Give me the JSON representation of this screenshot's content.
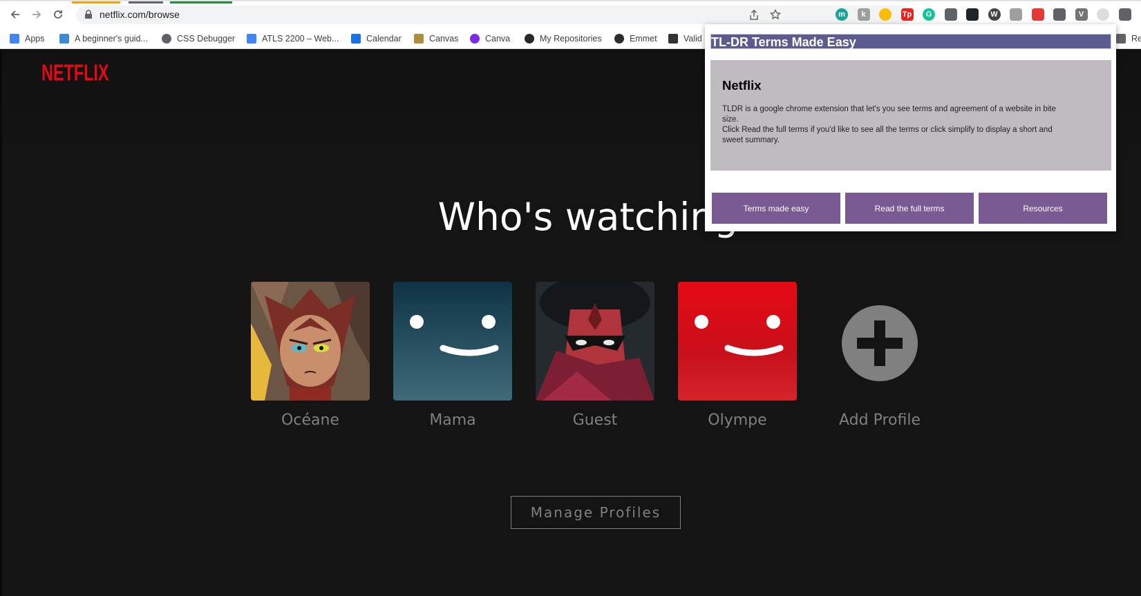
{
  "browser": {
    "url": "netflix.com/browse",
    "bookmarks": [
      {
        "label": "Apps",
        "icon": "apps-grid-icon",
        "color": "#4285f4"
      },
      {
        "label": "A beginner's guid...",
        "icon": "beginner-guide-icon",
        "color": "#3b8bd6"
      },
      {
        "label": "CSS Debugger",
        "icon": "globe-icon",
        "color": "#5f6368"
      },
      {
        "label": "ATLS 2200 – Web...",
        "icon": "docs-icon",
        "color": "#4285f4"
      },
      {
        "label": "Calendar",
        "icon": "calendar-icon",
        "color": "#1a73e8"
      },
      {
        "label": "Canvas",
        "icon": "canvas-icon",
        "color": "#b08d3c"
      },
      {
        "label": "Canva",
        "icon": "canva-icon",
        "color": "#7d2ae8"
      },
      {
        "label": "My Repositories",
        "icon": "github-icon",
        "color": "#24292e"
      },
      {
        "label": "Emmet",
        "icon": "emmet-icon",
        "color": "#2d2d2d"
      },
      {
        "label": "Valid",
        "icon": "validator-icon",
        "color": "#333333"
      },
      {
        "label": "Re",
        "icon": "reading-list-icon",
        "color": "#5f6368"
      }
    ],
    "extensions": [
      {
        "name": "m-extension-icon",
        "label": "m",
        "color": "#1aa39a"
      },
      {
        "name": "k-extension-icon",
        "label": "k",
        "color": "#9e9e9e"
      },
      {
        "name": "chrome-color-icon",
        "label": "",
        "color": "#fbbc04"
      },
      {
        "name": "tp-extension-icon",
        "label": "Tp",
        "color": "#e52620"
      },
      {
        "name": "grammarly-icon",
        "label": "G",
        "color": "#15c39a"
      },
      {
        "name": "camera-icon",
        "label": "",
        "color": "#5f6368"
      },
      {
        "name": "react-devtools-icon",
        "label": "",
        "color": "#20232a"
      },
      {
        "name": "wordpress-icon",
        "label": "W",
        "color": "#464342"
      },
      {
        "name": "document-icon",
        "label": "",
        "color": "#9e9e9e"
      },
      {
        "name": "colorpick-icon",
        "label": "",
        "color": "#e53935"
      },
      {
        "name": "settings-gear-icon",
        "label": "",
        "color": "#5f6368"
      },
      {
        "name": "vue-devtools-icon",
        "label": "V",
        "color": "#757575"
      },
      {
        "name": "tldr-extension-icon",
        "label": "",
        "color": "#dadce0"
      },
      {
        "name": "puzzle-extensions-icon",
        "label": "",
        "color": "#5f6368"
      }
    ]
  },
  "netflix": {
    "logo": "NETFLIX",
    "heading": "Who's watching?",
    "profiles": [
      {
        "name": "Océane",
        "avatar": "catra-avatar"
      },
      {
        "name": "Mama",
        "avatar": "blue-smile-avatar"
      },
      {
        "name": "Guest",
        "avatar": "masked-villain-avatar"
      },
      {
        "name": "Olympe",
        "avatar": "red-smile-avatar"
      },
      {
        "name": "Add Profile",
        "avatar": "add-profile-icon"
      }
    ],
    "manage_label": "Manage Profiles"
  },
  "popup": {
    "title": "TL-DR Terms Made Easy",
    "card_title": "Netflix",
    "card_body_1": "TLDR is a google chrome extension that let's you see terms and agreement of a website in bite size.",
    "card_body_2": "Click Read the full terms if you'd like to see all the terms or click simplify to display a short and sweet summary.",
    "buttons": [
      "Terms made easy",
      "Read the full terms",
      "Resources"
    ]
  },
  "colors": {
    "netflix_red": "#e50914",
    "popup_header": "#5b5b8f",
    "popup_card": "#c0bbc0",
    "popup_button": "#7a5a92"
  }
}
